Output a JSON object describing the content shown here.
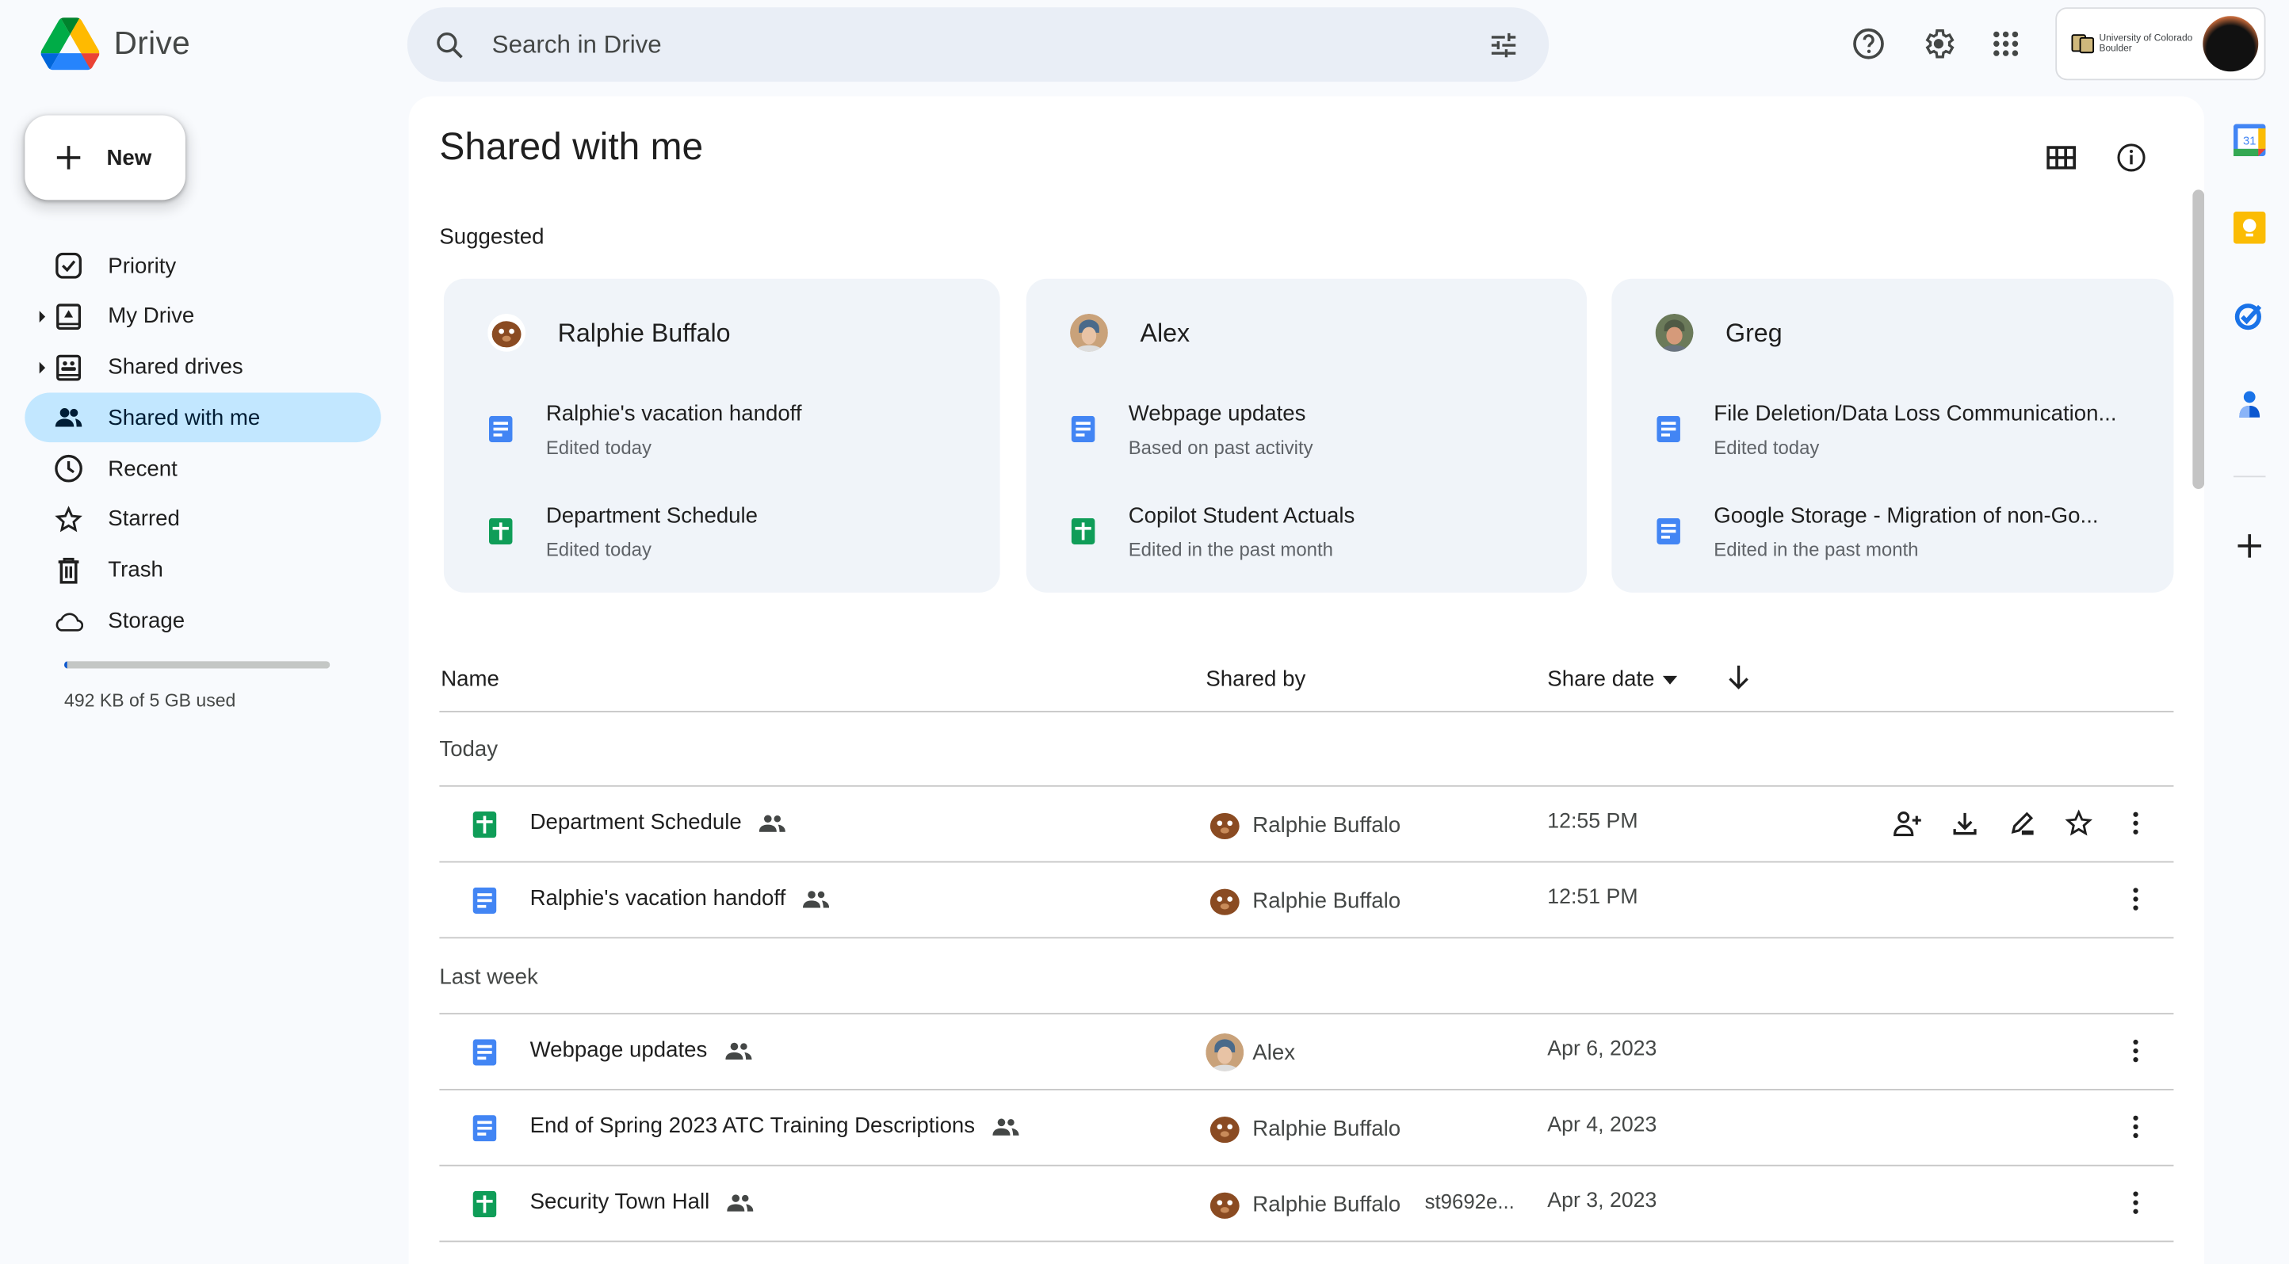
{
  "app": {
    "name": "Drive"
  },
  "search": {
    "placeholder": "Search in Drive",
    "value": ""
  },
  "header": {
    "icons": [
      "help-icon",
      "settings-icon",
      "apps-grid-icon"
    ],
    "org": {
      "line1": "University of Colorado",
      "line2": "Boulder"
    }
  },
  "new_button": {
    "label": "New"
  },
  "sidebar": {
    "items": [
      {
        "label": "Priority",
        "icon": "priority-icon",
        "expandable": false,
        "active": false
      },
      {
        "label": "My Drive",
        "icon": "my-drive-icon",
        "expandable": true,
        "active": false
      },
      {
        "label": "Shared drives",
        "icon": "shared-drives-icon",
        "expandable": true,
        "active": false
      },
      {
        "label": "Shared with me",
        "icon": "people-icon",
        "expandable": false,
        "active": true
      },
      {
        "label": "Recent",
        "icon": "clock-icon",
        "expandable": false,
        "active": false
      },
      {
        "label": "Starred",
        "icon": "star-icon",
        "expandable": false,
        "active": false
      },
      {
        "label": "Trash",
        "icon": "trash-icon",
        "expandable": false,
        "active": false
      },
      {
        "label": "Storage",
        "icon": "cloud-icon",
        "expandable": false,
        "active": false
      }
    ],
    "storage": {
      "text": "492 KB of 5 GB used",
      "used_fraction": 0.0001
    }
  },
  "main": {
    "title": "Shared with me",
    "suggested_label": "Suggested",
    "suggested": [
      {
        "person": "Ralphie Buffalo",
        "files": [
          {
            "type": "doc",
            "name": "Ralphie's vacation handoff",
            "reason": "Edited today"
          },
          {
            "type": "sheet",
            "name": "Department Schedule",
            "reason": "Edited today"
          }
        ]
      },
      {
        "person": "Alex",
        "files": [
          {
            "type": "doc",
            "name": "Webpage updates",
            "reason": "Based on past activity"
          },
          {
            "type": "sheet",
            "name": "Copilot Student Actuals",
            "reason": "Edited in the past month"
          }
        ]
      },
      {
        "person": "Greg",
        "files": [
          {
            "type": "doc",
            "name": "File Deletion/Data Loss Communication...",
            "reason": "Edited today"
          },
          {
            "type": "doc",
            "name": "Google Storage - Migration of non-Go...",
            "reason": "Edited in the past month"
          }
        ]
      }
    ],
    "table": {
      "columns": {
        "name": "Name",
        "shared_by": "Shared by",
        "share_date": "Share date"
      },
      "groups": [
        {
          "label": "Today",
          "rows": [
            {
              "type": "sheet",
              "name": "Department Schedule",
              "shared_by": "Ralphie Buffalo",
              "extra": "",
              "date": "12:55 PM",
              "hovered": true
            },
            {
              "type": "doc",
              "name": "Ralphie's vacation handoff",
              "shared_by": "Ralphie Buffalo",
              "extra": "",
              "date": "12:51 PM",
              "hovered": false
            }
          ]
        },
        {
          "label": "Last week",
          "rows": [
            {
              "type": "doc",
              "name": "Webpage updates",
              "shared_by": "Alex",
              "extra": "",
              "date": "Apr 6, 2023",
              "hovered": false
            },
            {
              "type": "doc",
              "name": "End of Spring 2023 ATC Training Descriptions",
              "shared_by": "Ralphie Buffalo",
              "extra": "",
              "date": "Apr 4, 2023",
              "hovered": false
            },
            {
              "type": "sheet",
              "name": "Security Town Hall",
              "shared_by": "Ralphie Buffalo",
              "extra": "st9692e...",
              "date": "Apr 3, 2023",
              "hovered": false
            }
          ]
        }
      ],
      "hover_actions": [
        "share-icon",
        "download-icon",
        "rename-icon",
        "star-icon"
      ]
    }
  },
  "right_rail": {
    "apps": [
      "calendar-icon",
      "keep-icon",
      "tasks-icon",
      "contacts-icon"
    ],
    "calendar_day": "31"
  },
  "colors": {
    "accent": "#0b57d0",
    "active_nav": "#c2e7ff",
    "doc": "#4285f4",
    "sheet": "#0f9d58",
    "card_bg": "#f0f4f9"
  }
}
